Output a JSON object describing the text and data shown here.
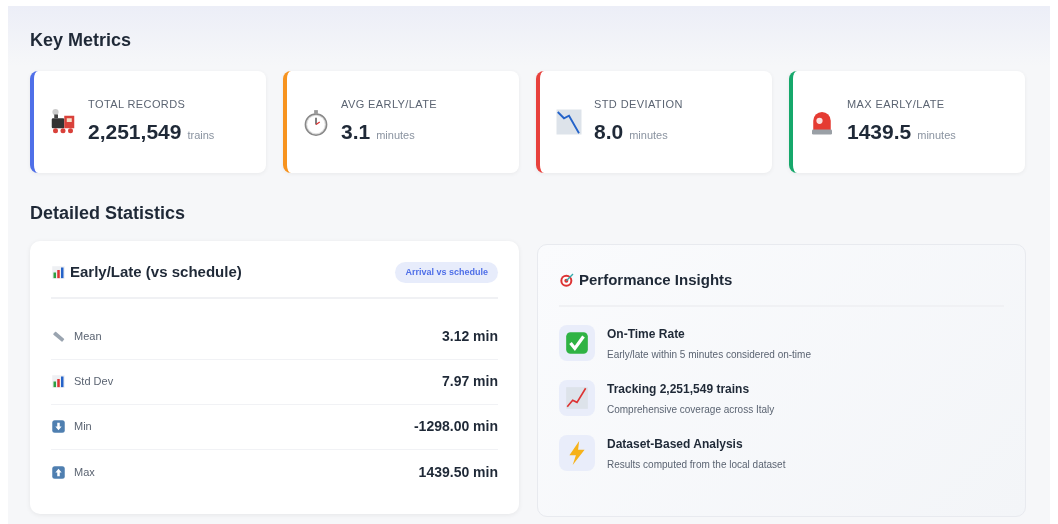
{
  "sections": [
    {
      "title": "Key Metrics"
    },
    {
      "title": "Detailed Statistics"
    }
  ],
  "metrics": [
    {
      "label": "TOTAL RECORDS",
      "value": "2,251,549",
      "unit": "trains",
      "color": "#4f6fe8"
    },
    {
      "label": "AVG EARLY/LATE",
      "value": "3.1",
      "unit": "minutes",
      "color": "#f7931e"
    },
    {
      "label": "STD DEVIATION",
      "value": "8.0",
      "unit": "minutes",
      "color": "#e8413c"
    },
    {
      "label": "MAX EARLY/LATE",
      "value": "1439.5",
      "unit": "minutes",
      "color": "#16a86b"
    }
  ],
  "stats_card": {
    "title": "Early/Late (vs schedule)",
    "badge": "Arrival vs schedule",
    "rows": [
      {
        "label": "Mean",
        "value": "3.12 min"
      },
      {
        "label": "Std Dev",
        "value": "7.97 min"
      },
      {
        "label": "Min",
        "value": "-1298.00 min"
      },
      {
        "label": "Max",
        "value": "1439.50 min"
      }
    ]
  },
  "insights_card": {
    "title": "Performance Insights",
    "items": [
      {
        "title": "On-Time Rate",
        "description": "Early/late within 5 minutes considered on-time"
      },
      {
        "title": "Tracking 2,251,549 trains",
        "description": "Comprehensive coverage across Italy"
      },
      {
        "title": "Dataset-Based Analysis",
        "description": "Results computed from the local dataset"
      }
    ]
  }
}
